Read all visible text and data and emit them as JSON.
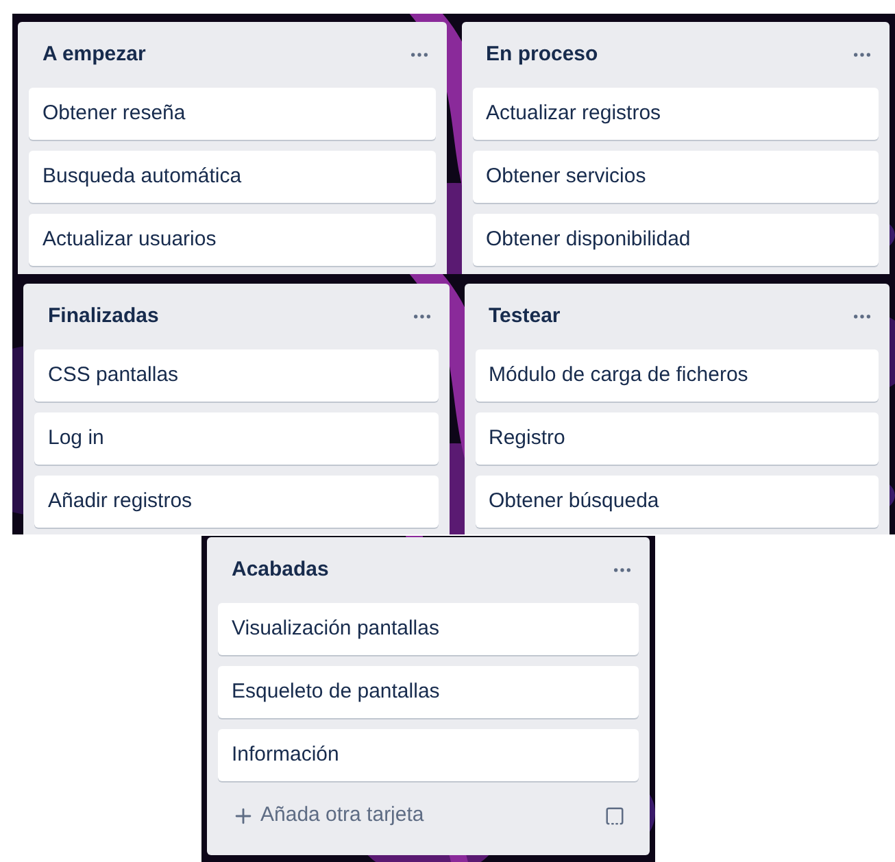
{
  "sections": [
    {
      "lists": [
        {
          "title": "A empezar",
          "cards": [
            "Obtener reseña",
            "Busqueda automática",
            "Actualizar usuarios"
          ]
        },
        {
          "title": "En proceso",
          "cards": [
            "Actualizar registros",
            "Obtener servicios",
            "Obtener disponibilidad"
          ]
        }
      ]
    },
    {
      "lists": [
        {
          "title": "Finalizadas",
          "cards": [
            "CSS pantallas",
            "Log in",
            "Añadir registros"
          ]
        },
        {
          "title": "Testear",
          "cards": [
            "Módulo de carga de ficheros",
            "Registro",
            "Obtener búsqueda"
          ]
        }
      ]
    },
    {
      "lists": [
        {
          "title": "Acabadas",
          "cards": [
            "Visualización pantallas",
            "Esqueleto de pantallas",
            "Información"
          ],
          "add_card": "Añada otra tarjeta"
        }
      ]
    }
  ]
}
